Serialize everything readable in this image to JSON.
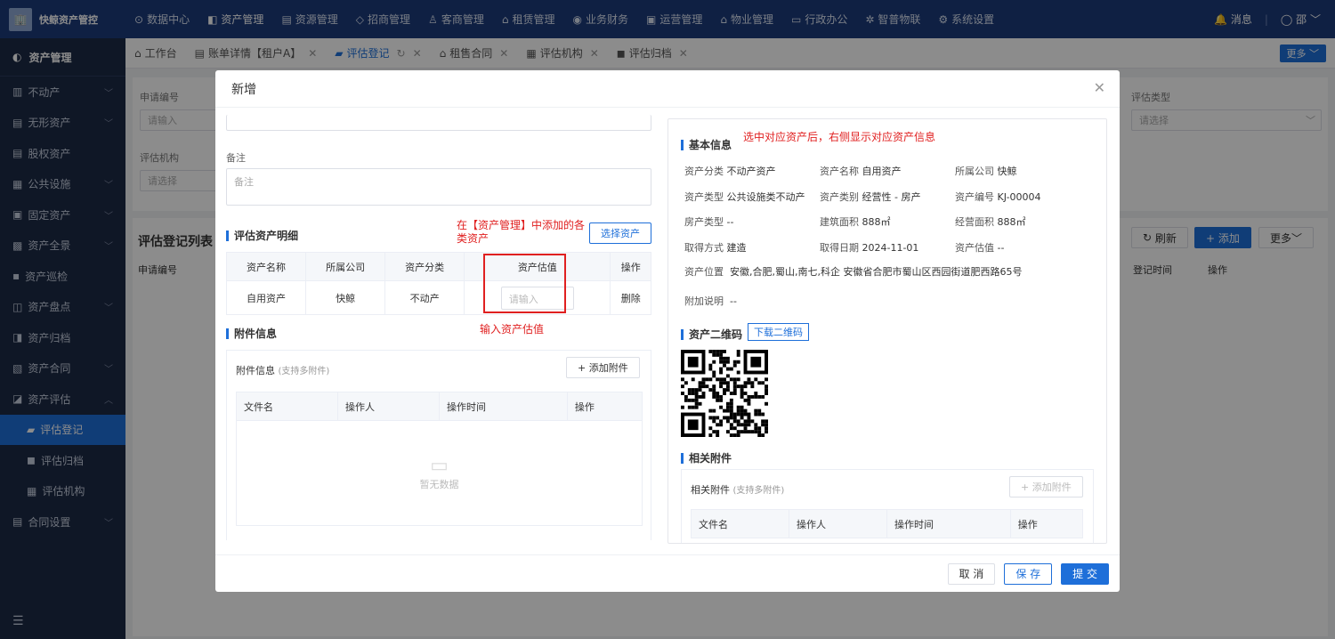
{
  "app": {
    "name": "快鲸资产管控",
    "logo_glyph": "🏢"
  },
  "topnav": [
    {
      "label": "数据中心",
      "icon": "⊙"
    },
    {
      "label": "资产管理",
      "icon": "◧",
      "active": true
    },
    {
      "label": "资源管理",
      "icon": "▤"
    },
    {
      "label": "招商管理",
      "icon": "◇"
    },
    {
      "label": "客商管理",
      "icon": "♙"
    },
    {
      "label": "租赁管理",
      "icon": "⌂"
    },
    {
      "label": "业务财务",
      "icon": "◉"
    },
    {
      "label": "运营管理",
      "icon": "▣"
    },
    {
      "label": "物业管理",
      "icon": "⌂"
    },
    {
      "label": "行政办公",
      "icon": "▭"
    },
    {
      "label": "智普物联",
      "icon": "✲"
    },
    {
      "label": "系统设置",
      "icon": "⚙"
    }
  ],
  "topright": {
    "messages": "消息",
    "user": "邵"
  },
  "sidebar": {
    "header": "资产管理",
    "items": [
      {
        "label": "不动产",
        "icon": "▥",
        "chev": "﹀"
      },
      {
        "label": "无形资产",
        "icon": "▤",
        "chev": "﹀"
      },
      {
        "label": "股权资产",
        "icon": "▤",
        "chev": ""
      },
      {
        "label": "公共设施",
        "icon": "▦",
        "chev": "﹀"
      },
      {
        "label": "固定资产",
        "icon": "▣",
        "chev": "﹀"
      },
      {
        "label": "资产全景",
        "icon": "▩",
        "chev": "﹀"
      },
      {
        "label": "资产巡检",
        "icon": "▪",
        "chev": ""
      },
      {
        "label": "资产盘点",
        "icon": "◫",
        "chev": "﹀"
      },
      {
        "label": "资产归档",
        "icon": "◨",
        "chev": ""
      },
      {
        "label": "资产合同",
        "icon": "▧",
        "chev": "﹀"
      },
      {
        "label": "资产评估",
        "icon": "◪",
        "chev": "︿"
      }
    ],
    "subitems": [
      {
        "label": "评估登记",
        "icon": "▰",
        "active": true
      },
      {
        "label": "评估归档",
        "icon": "◼"
      },
      {
        "label": "评估机构",
        "icon": "▦"
      }
    ],
    "after": [
      {
        "label": "合同设置",
        "icon": "▤",
        "chev": "﹀"
      }
    ],
    "collapse_icon": "☰"
  },
  "tabs": [
    {
      "label": "工作台",
      "icon": "⌂",
      "close": ""
    },
    {
      "label": "账单详情【租户A】",
      "icon": "▤",
      "close": "✕"
    },
    {
      "label": "评估登记",
      "icon": "▰",
      "close": "✕",
      "refresh": "↻",
      "active": true
    },
    {
      "label": "租售合同",
      "icon": "⌂",
      "close": "✕"
    },
    {
      "label": "评估机构",
      "icon": "▦",
      "close": "✕"
    },
    {
      "label": "评估归档",
      "icon": "◼",
      "close": "✕"
    }
  ],
  "tabs_more": "更多 ﹀",
  "bg": {
    "apply_no_label": "申请编号",
    "apply_no_ph": "请输入",
    "org_label": "评估机构",
    "org_ph": "请选择",
    "type_label": "评估类型",
    "type_ph": "请选择",
    "list_title": "评估登记列表",
    "refresh": "刷新",
    "add": "+ 添加",
    "more": "更多﹀",
    "col_apply_no": "申请编号",
    "col_time": "登记时间",
    "col_op": "操作"
  },
  "modal": {
    "title": "新增",
    "close": "✕",
    "remark_label": "备注",
    "remark_ph": "备注",
    "detail_title": "评估资产明细",
    "select_asset_btn": "选择资产",
    "table_headers": [
      "资产名称",
      "所属公司",
      "资产分类",
      "资产估值",
      "操作"
    ],
    "rows": [
      {
        "name": "自用资产",
        "company": "快鲸",
        "category": "不动产",
        "value_ph": "请输入",
        "op": "删除"
      }
    ],
    "attach_title": "附件信息",
    "attach_box_label": "附件信息",
    "attach_box_hint": "(支持多附件)",
    "add_attach_btn": "+ 添加附件",
    "attach_headers": [
      "文件名",
      "操作人",
      "操作时间",
      "操作"
    ],
    "empty_text": "暂无数据",
    "annotations": {
      "a1": "在【资产管理】中添加的各类资产",
      "a2": "输入资产估值",
      "a3": "选中对应资产后，右侧显示对应资产信息"
    },
    "basic_title": "基本信息",
    "basic": [
      [
        {
          "k": "资产分类",
          "v": "不动产资产"
        },
        {
          "k": "资产名称",
          "v": "自用资产"
        },
        {
          "k": "所属公司",
          "v": "快鲸"
        }
      ],
      [
        {
          "k": "资产类型",
          "v": "公共设施类不动产"
        },
        {
          "k": "资产类别",
          "v": "经营性 - 房产"
        },
        {
          "k": "资产编号",
          "v": "KJ-00004"
        }
      ],
      [
        {
          "k": "房产类型",
          "v": "--"
        },
        {
          "k": "建筑面积",
          "v": "888㎡"
        },
        {
          "k": "经营面积",
          "v": "888㎡"
        }
      ],
      [
        {
          "k": "取得方式",
          "v": "建造"
        },
        {
          "k": "取得日期",
          "v": "2024-11-01"
        },
        {
          "k": "资产估值",
          "v": "--"
        }
      ]
    ],
    "location_k": "资产位置",
    "location_v": "安徽,合肥,蜀山,南七,科企 安徽省合肥市蜀山区西园街道肥西路65号",
    "remark2_k": "附加说明",
    "remark2_v": "--",
    "qr_title": "资产二维码",
    "qr_btn": "下载二维码",
    "related_title": "相关附件",
    "related_label": "相关附件",
    "related_hint": "(支持多附件)",
    "related_add": "+ 添加附件",
    "related_headers": [
      "文件名",
      "操作人",
      "操作时间",
      "操作"
    ],
    "footer": {
      "cancel": "取 消",
      "save": "保 存",
      "submit": "提 交"
    }
  }
}
